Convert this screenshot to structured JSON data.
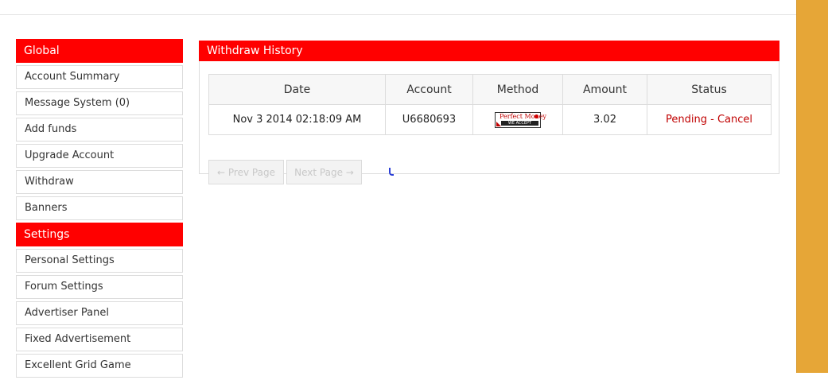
{
  "sidebar": {
    "global_heading": "Global",
    "global_items": [
      {
        "label": "Account Summary"
      },
      {
        "label": "Message System (0)"
      },
      {
        "label": "Add funds"
      },
      {
        "label": "Upgrade Account"
      },
      {
        "label": "Withdraw"
      },
      {
        "label": "Banners"
      }
    ],
    "settings_heading": "Settings",
    "settings_items": [
      {
        "label": "Personal Settings"
      },
      {
        "label": "Forum Settings"
      },
      {
        "label": "Advertiser Panel"
      },
      {
        "label": "Fixed Advertisement"
      },
      {
        "label": "Excellent Grid Game"
      }
    ]
  },
  "main": {
    "title": "Withdraw History",
    "columns": [
      "Date",
      "Account",
      "Method",
      "Amount",
      "Status"
    ],
    "rows": [
      {
        "date": "Nov 3 2014 02:18:09 AM",
        "account": "U6680693",
        "method_logo": "Perfect Money",
        "method_logo_sub": "WE ACCEPT",
        "amount": "3.02",
        "status": "Pending",
        "separator": " - ",
        "cancel": "Cancel"
      }
    ],
    "pager": {
      "prev": "← Prev Page",
      "next": "Next Page →"
    }
  },
  "colors": {
    "header_red": "#ff0000",
    "status_red": "#c00000",
    "right_bar": "#e6a637"
  }
}
